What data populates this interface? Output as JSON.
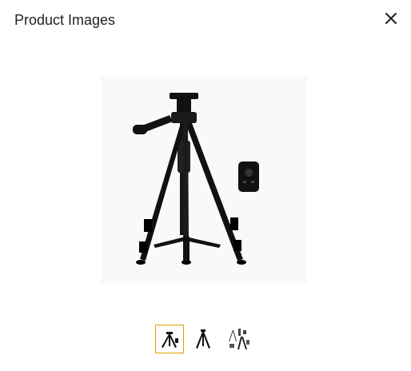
{
  "dialog": {
    "title": "Product Images",
    "close_icon": "close-icon"
  },
  "main_image": {
    "subject": "tripod-with-remote"
  },
  "thumbnails": {
    "selected_index": 0,
    "selected_border_color": "#e0a000",
    "items": [
      {
        "subject": "tripod-with-remote"
      },
      {
        "subject": "tripod"
      },
      {
        "subject": "tripod-accessories"
      }
    ]
  }
}
